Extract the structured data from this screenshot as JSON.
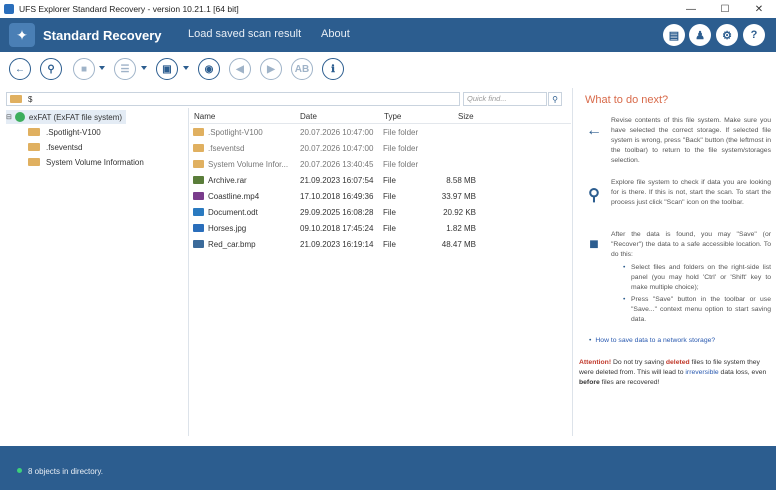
{
  "window": {
    "title": "UFS Explorer Standard Recovery - version 10.21.1 [64 bit]"
  },
  "header": {
    "product": "Standard Recovery",
    "menu": [
      "Load saved scan result",
      "About"
    ]
  },
  "path": {
    "value": "$"
  },
  "search": {
    "placeholder": "Quick find..."
  },
  "tree": {
    "root": "exFAT (ExFAT file system)",
    "children": [
      ".Spotlight-V100",
      ".fseventsd",
      "System Volume Information"
    ]
  },
  "list": {
    "columns": [
      "Name",
      "Date",
      "Type",
      "Size"
    ],
    "rows": [
      {
        "name": ".Spotlight-V100",
        "date": "20.07.2026 10:47:00",
        "type": "File folder",
        "size": "",
        "icon": "folder-icon"
      },
      {
        "name": ".fseventsd",
        "date": "20.07.2026 10:47:00",
        "type": "File folder",
        "size": "",
        "icon": "folder-icon"
      },
      {
        "name": "System Volume Infor...",
        "date": "20.07.2026 13:40:45",
        "type": "File folder",
        "size": "",
        "icon": "folder-icon"
      },
      {
        "name": "Archive.rar",
        "date": "21.09.2023 16:07:54",
        "type": "File",
        "size": "8.58 MB",
        "icon": "archive-icon"
      },
      {
        "name": "Coastline.mp4",
        "date": "17.10.2018 16:49:36",
        "type": "File",
        "size": "33.97 MB",
        "icon": "video-icon"
      },
      {
        "name": "Document.odt",
        "date": "29.09.2025 16:08:28",
        "type": "File",
        "size": "20.92 KB",
        "icon": "document-icon"
      },
      {
        "name": "Horses.jpg",
        "date": "09.10.2018 17:45:24",
        "type": "File",
        "size": "1.82 MB",
        "icon": "image-icon"
      },
      {
        "name": "Red_car.bmp",
        "date": "21.09.2023 16:19:14",
        "type": "File",
        "size": "48.47 MB",
        "icon": "image-icon"
      }
    ]
  },
  "help": {
    "title": "What to do next?",
    "p1": "Revise contents of this file system. Make sure you have selected the correct storage. If selected file system is wrong, press \"Back\" button (the leftmost in the toolbar) to return to the file system/storages selection.",
    "p2": "Explore file system to check if data you are looking for is there. If this is not, start the scan. To start the process just click \"Scan\" icon on the toolbar.",
    "p3": "After the data is found, you may \"Save\" (or \"Recover\") the data to a safe accessible location. To do this:",
    "b1": "Select files and folders on the right-side list panel (you may hold 'Ctrl' or 'Shift' key to make multiple choice);",
    "b2": "Press \"Save\" button in the toolbar or use \"Save...\" context menu option to start saving data.",
    "link": "How to save data to a network storage?",
    "warn_label": "Attention!",
    "warn_a": " Do not try saving ",
    "warn_deleted": "deleted",
    "warn_b": " files to file system they were deleted from. This will lead to ",
    "warn_irrev": "irreversible",
    "warn_c": " data loss, even ",
    "warn_before": "before",
    "warn_d": " files are recovered!"
  },
  "status": {
    "text": "8 objects in directory."
  },
  "colors": {
    "accent": "#2c5d8f",
    "title_orange": "#d86a4a",
    "warn_red": "#c0392b"
  }
}
